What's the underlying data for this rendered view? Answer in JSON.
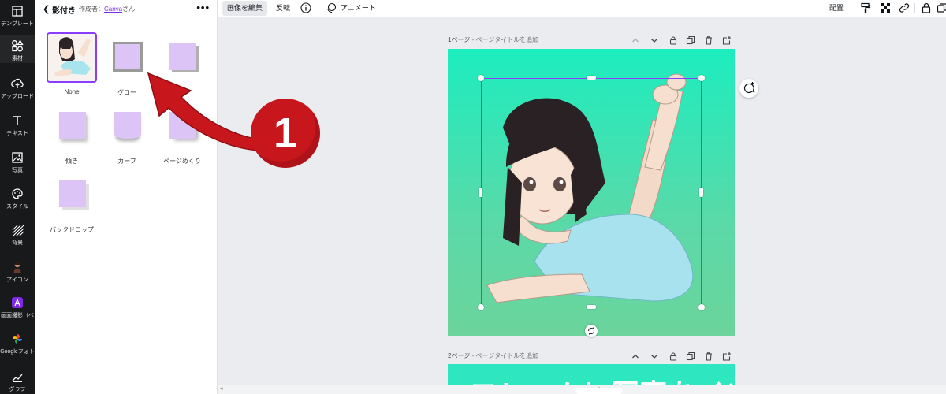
{
  "rail": [
    {
      "name": "template",
      "label": "テンプレート",
      "icon": "layout-icon"
    },
    {
      "name": "elements",
      "label": "素材",
      "icon": "shapes-icon",
      "active": true
    },
    {
      "name": "upload",
      "label": "アップロード",
      "icon": "cloud-upload-icon"
    },
    {
      "name": "text",
      "label": "テキスト",
      "icon": "text-t-icon"
    },
    {
      "name": "photos",
      "label": "写真",
      "icon": "photo-icon"
    },
    {
      "name": "style",
      "label": "スタイル",
      "icon": "palette-icon"
    },
    {
      "name": "background",
      "label": "背景",
      "icon": "hatch-icon"
    },
    {
      "name": "icon",
      "label": "アイコン",
      "icon": "avatar-icon"
    },
    {
      "name": "screenshot",
      "label": "画面撮影（ペ",
      "icon": "app-a-icon"
    },
    {
      "name": "google-photos",
      "label": "Googleフォト",
      "icon": "pinwheel-icon"
    },
    {
      "name": "graph",
      "label": "グラフ",
      "icon": "chart-icon"
    }
  ],
  "panel": {
    "title": "影付き",
    "author_prefix": "作成者：",
    "author_link": "Canva",
    "author_suffix": "さん",
    "more": "•••",
    "effects": [
      {
        "label": "None"
      },
      {
        "label": "グロー"
      },
      {
        "label": ""
      },
      {
        "label": "傾き"
      },
      {
        "label": "カーブ"
      },
      {
        "label": "ページめくり"
      },
      {
        "label": "バックドロップ"
      }
    ]
  },
  "annotation": {
    "number": "1"
  },
  "topbar": {
    "edit_image": "画像を編集",
    "flip": "反転",
    "animate": "アニメート",
    "position": "配置"
  },
  "pages": [
    {
      "label": "1ページ",
      "title_placeholder": "- ページタイトルを追加"
    },
    {
      "label": "2ページ",
      "title_placeholder": "- ページタイトルを追加",
      "preview_text": "フレームに写真をイン"
    }
  ],
  "colors": {
    "accent": "#8b3dff",
    "rail_bg": "#18191b",
    "page_bg": "#2ee6c0",
    "arrow": "#c8161d"
  }
}
